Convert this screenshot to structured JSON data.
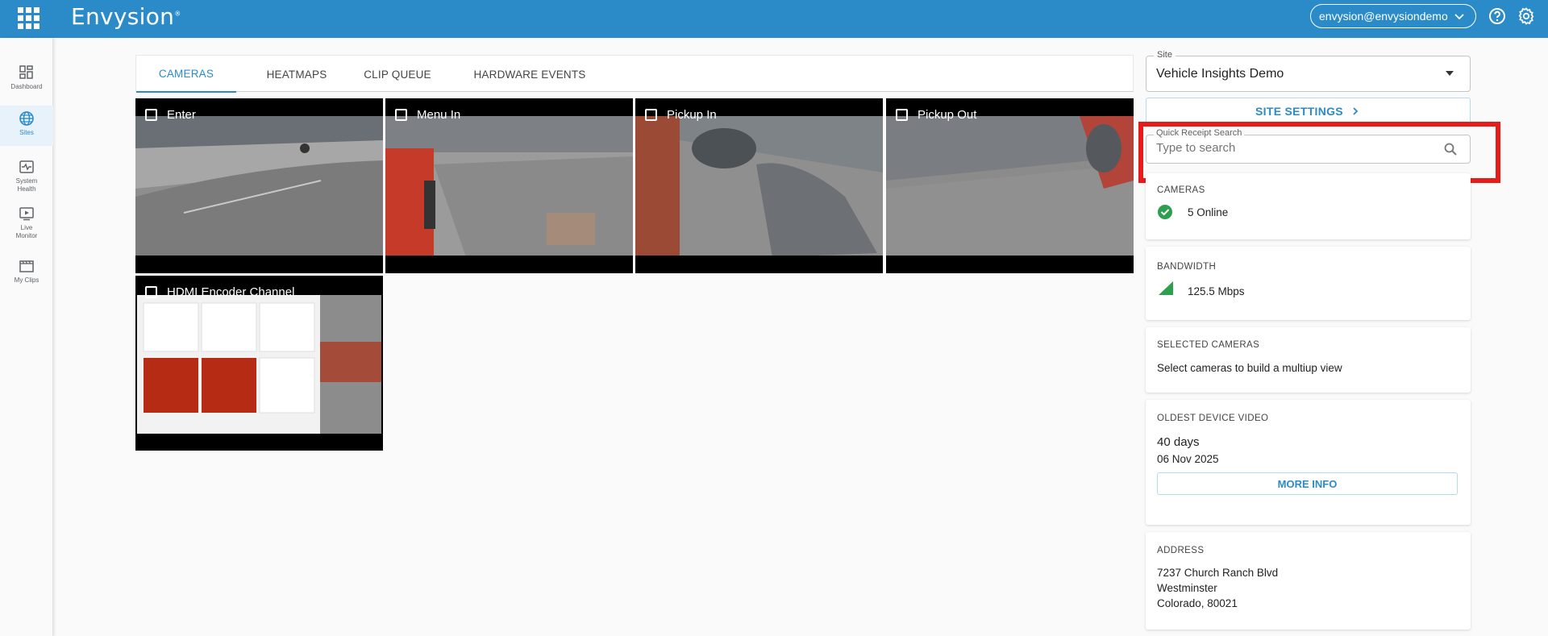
{
  "header": {
    "brand": "Envysion",
    "brand_mark": "®",
    "user_email": "envysion@envysiondemo",
    "colors": {
      "bar": "#2a8bc8",
      "accent": "#2a8bc8",
      "highlight": "#e81b1b",
      "online": "#2e9e4f"
    }
  },
  "sidebar": {
    "items": [
      {
        "label": "Dashboard",
        "icon": "dashboard-icon"
      },
      {
        "label": "Sites",
        "icon": "globe-icon",
        "active": true
      },
      {
        "label": "System Health",
        "icon": "system-health-icon"
      },
      {
        "label": "Live Monitor",
        "icon": "live-monitor-icon"
      },
      {
        "label": "My Clips",
        "icon": "clips-icon"
      }
    ]
  },
  "tabs": [
    {
      "label": "CAMERAS",
      "active": true
    },
    {
      "label": "HEATMAPS"
    },
    {
      "label": "CLIP QUEUE"
    },
    {
      "label": "HARDWARE EVENTS"
    }
  ],
  "cameras": [
    {
      "name": "Enter"
    },
    {
      "name": "Menu In"
    },
    {
      "name": "Pickup In"
    },
    {
      "name": "Pickup Out"
    },
    {
      "name": "HDMI Encoder Channel"
    }
  ],
  "site": {
    "legend": "Site",
    "value": "Vehicle Insights Demo",
    "settings_label": "SITE SETTINGS"
  },
  "quick_receipt": {
    "legend": "Quick Receipt Search",
    "placeholder": "Type to search"
  },
  "cards": {
    "cameras": {
      "title": "CAMERAS",
      "status": "5 Online"
    },
    "bandwidth": {
      "title": "BANDWIDTH",
      "value": "125.5 Mbps"
    },
    "selected": {
      "title": "SELECTED CAMERAS",
      "text": "Select cameras to build a multiup view"
    },
    "oldest": {
      "title": "OLDEST DEVICE VIDEO",
      "days": "40 days",
      "date": "06 Nov 2025",
      "button": "MORE INFO"
    },
    "address": {
      "title": "ADDRESS",
      "line1": "7237 Church Ranch Blvd",
      "line2": "Westminster",
      "line3": "Colorado, 80021"
    }
  }
}
